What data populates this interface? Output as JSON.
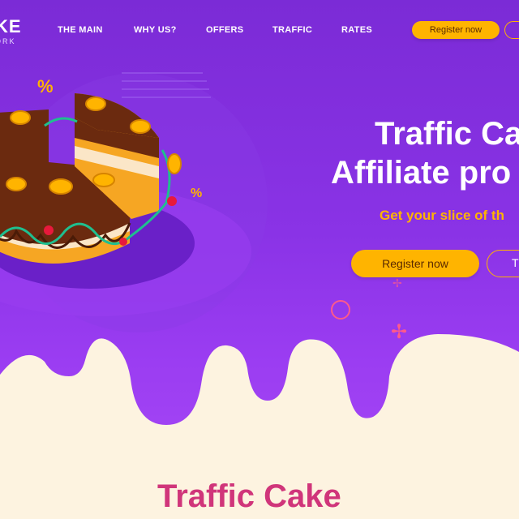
{
  "brand": {
    "name_line1": "KE",
    "name_line2": "ORK"
  },
  "nav": {
    "items": [
      "THE MAIN",
      "WHY US?",
      "OFFERS",
      "TRAFFIC",
      "RATES"
    ],
    "register_label": "Register now"
  },
  "hero": {
    "title_line1": "Traffic Ca",
    "title_line2": "Affiliate pro",
    "subtitle": "Get your slice of th",
    "register_label": "Register now",
    "secondary_label": "T",
    "percent_symbol": "%"
  },
  "section": {
    "title": "Traffic Cake"
  },
  "colors": {
    "purple": "#7b2bd6",
    "accent": "#ffb400",
    "cream": "#fdf3e0",
    "pink": "#d0357a",
    "chocolate": "#6b2a0f"
  },
  "icons": [
    "percent-icon",
    "coin-icon",
    "circle-outline-icon",
    "sparkle-icon"
  ]
}
